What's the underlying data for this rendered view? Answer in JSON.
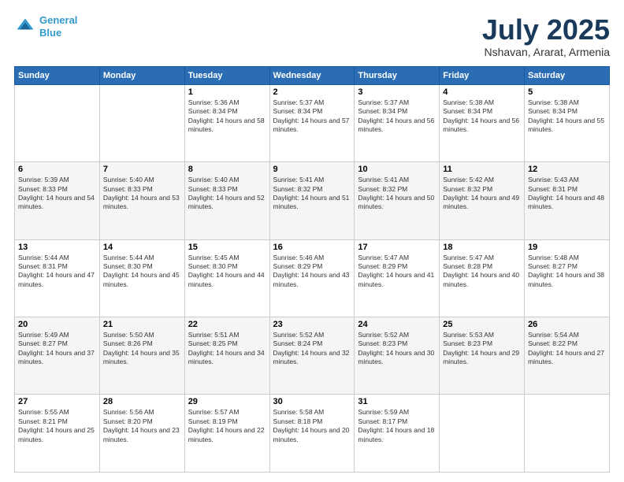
{
  "logo": {
    "line1": "General",
    "line2": "Blue"
  },
  "title": {
    "month_year": "July 2025",
    "location": "Nshavan, Ararat, Armenia"
  },
  "weekdays": [
    "Sunday",
    "Monday",
    "Tuesday",
    "Wednesday",
    "Thursday",
    "Friday",
    "Saturday"
  ],
  "weeks": [
    [
      {
        "day": "",
        "sunrise": "",
        "sunset": "",
        "daylight": ""
      },
      {
        "day": "",
        "sunrise": "",
        "sunset": "",
        "daylight": ""
      },
      {
        "day": "1",
        "sunrise": "Sunrise: 5:36 AM",
        "sunset": "Sunset: 8:34 PM",
        "daylight": "Daylight: 14 hours and 58 minutes."
      },
      {
        "day": "2",
        "sunrise": "Sunrise: 5:37 AM",
        "sunset": "Sunset: 8:34 PM",
        "daylight": "Daylight: 14 hours and 57 minutes."
      },
      {
        "day": "3",
        "sunrise": "Sunrise: 5:37 AM",
        "sunset": "Sunset: 8:34 PM",
        "daylight": "Daylight: 14 hours and 56 minutes."
      },
      {
        "day": "4",
        "sunrise": "Sunrise: 5:38 AM",
        "sunset": "Sunset: 8:34 PM",
        "daylight": "Daylight: 14 hours and 56 minutes."
      },
      {
        "day": "5",
        "sunrise": "Sunrise: 5:38 AM",
        "sunset": "Sunset: 8:34 PM",
        "daylight": "Daylight: 14 hours and 55 minutes."
      }
    ],
    [
      {
        "day": "6",
        "sunrise": "Sunrise: 5:39 AM",
        "sunset": "Sunset: 8:33 PM",
        "daylight": "Daylight: 14 hours and 54 minutes."
      },
      {
        "day": "7",
        "sunrise": "Sunrise: 5:40 AM",
        "sunset": "Sunset: 8:33 PM",
        "daylight": "Daylight: 14 hours and 53 minutes."
      },
      {
        "day": "8",
        "sunrise": "Sunrise: 5:40 AM",
        "sunset": "Sunset: 8:33 PM",
        "daylight": "Daylight: 14 hours and 52 minutes."
      },
      {
        "day": "9",
        "sunrise": "Sunrise: 5:41 AM",
        "sunset": "Sunset: 8:32 PM",
        "daylight": "Daylight: 14 hours and 51 minutes."
      },
      {
        "day": "10",
        "sunrise": "Sunrise: 5:41 AM",
        "sunset": "Sunset: 8:32 PM",
        "daylight": "Daylight: 14 hours and 50 minutes."
      },
      {
        "day": "11",
        "sunrise": "Sunrise: 5:42 AM",
        "sunset": "Sunset: 8:32 PM",
        "daylight": "Daylight: 14 hours and 49 minutes."
      },
      {
        "day": "12",
        "sunrise": "Sunrise: 5:43 AM",
        "sunset": "Sunset: 8:31 PM",
        "daylight": "Daylight: 14 hours and 48 minutes."
      }
    ],
    [
      {
        "day": "13",
        "sunrise": "Sunrise: 5:44 AM",
        "sunset": "Sunset: 8:31 PM",
        "daylight": "Daylight: 14 hours and 47 minutes."
      },
      {
        "day": "14",
        "sunrise": "Sunrise: 5:44 AM",
        "sunset": "Sunset: 8:30 PM",
        "daylight": "Daylight: 14 hours and 45 minutes."
      },
      {
        "day": "15",
        "sunrise": "Sunrise: 5:45 AM",
        "sunset": "Sunset: 8:30 PM",
        "daylight": "Daylight: 14 hours and 44 minutes."
      },
      {
        "day": "16",
        "sunrise": "Sunrise: 5:46 AM",
        "sunset": "Sunset: 8:29 PM",
        "daylight": "Daylight: 14 hours and 43 minutes."
      },
      {
        "day": "17",
        "sunrise": "Sunrise: 5:47 AM",
        "sunset": "Sunset: 8:29 PM",
        "daylight": "Daylight: 14 hours and 41 minutes."
      },
      {
        "day": "18",
        "sunrise": "Sunrise: 5:47 AM",
        "sunset": "Sunset: 8:28 PM",
        "daylight": "Daylight: 14 hours and 40 minutes."
      },
      {
        "day": "19",
        "sunrise": "Sunrise: 5:48 AM",
        "sunset": "Sunset: 8:27 PM",
        "daylight": "Daylight: 14 hours and 38 minutes."
      }
    ],
    [
      {
        "day": "20",
        "sunrise": "Sunrise: 5:49 AM",
        "sunset": "Sunset: 8:27 PM",
        "daylight": "Daylight: 14 hours and 37 minutes."
      },
      {
        "day": "21",
        "sunrise": "Sunrise: 5:50 AM",
        "sunset": "Sunset: 8:26 PM",
        "daylight": "Daylight: 14 hours and 35 minutes."
      },
      {
        "day": "22",
        "sunrise": "Sunrise: 5:51 AM",
        "sunset": "Sunset: 8:25 PM",
        "daylight": "Daylight: 14 hours and 34 minutes."
      },
      {
        "day": "23",
        "sunrise": "Sunrise: 5:52 AM",
        "sunset": "Sunset: 8:24 PM",
        "daylight": "Daylight: 14 hours and 32 minutes."
      },
      {
        "day": "24",
        "sunrise": "Sunrise: 5:52 AM",
        "sunset": "Sunset: 8:23 PM",
        "daylight": "Daylight: 14 hours and 30 minutes."
      },
      {
        "day": "25",
        "sunrise": "Sunrise: 5:53 AM",
        "sunset": "Sunset: 8:23 PM",
        "daylight": "Daylight: 14 hours and 29 minutes."
      },
      {
        "day": "26",
        "sunrise": "Sunrise: 5:54 AM",
        "sunset": "Sunset: 8:22 PM",
        "daylight": "Daylight: 14 hours and 27 minutes."
      }
    ],
    [
      {
        "day": "27",
        "sunrise": "Sunrise: 5:55 AM",
        "sunset": "Sunset: 8:21 PM",
        "daylight": "Daylight: 14 hours and 25 minutes."
      },
      {
        "day": "28",
        "sunrise": "Sunrise: 5:56 AM",
        "sunset": "Sunset: 8:20 PM",
        "daylight": "Daylight: 14 hours and 23 minutes."
      },
      {
        "day": "29",
        "sunrise": "Sunrise: 5:57 AM",
        "sunset": "Sunset: 8:19 PM",
        "daylight": "Daylight: 14 hours and 22 minutes."
      },
      {
        "day": "30",
        "sunrise": "Sunrise: 5:58 AM",
        "sunset": "Sunset: 8:18 PM",
        "daylight": "Daylight: 14 hours and 20 minutes."
      },
      {
        "day": "31",
        "sunrise": "Sunrise: 5:59 AM",
        "sunset": "Sunset: 8:17 PM",
        "daylight": "Daylight: 14 hours and 18 minutes."
      },
      {
        "day": "",
        "sunrise": "",
        "sunset": "",
        "daylight": ""
      },
      {
        "day": "",
        "sunrise": "",
        "sunset": "",
        "daylight": ""
      }
    ]
  ]
}
